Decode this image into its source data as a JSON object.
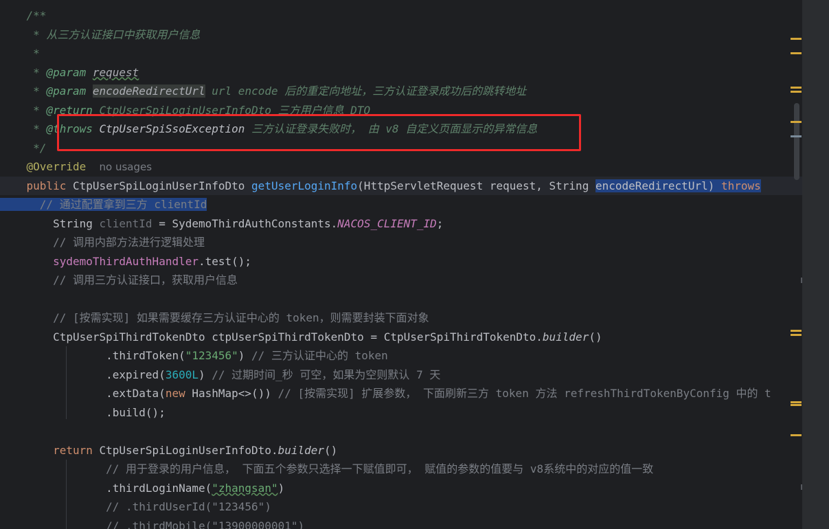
{
  "editor": {
    "lines": [
      {
        "segs": [
          [
            "    /**",
            "doc"
          ]
        ]
      },
      {
        "segs": [
          [
            "     * 从三方认证接口中获取用户信息",
            "doc"
          ]
        ]
      },
      {
        "segs": [
          [
            "     *",
            "doc"
          ]
        ]
      },
      {
        "segs": [
          [
            "     * ",
            "doc"
          ],
          [
            "@param",
            "doctag"
          ],
          [
            " ",
            "doc"
          ],
          [
            "request",
            "docparam"
          ]
        ]
      },
      {
        "segs": [
          [
            "     * ",
            "doc"
          ],
          [
            "@param",
            "doctag"
          ],
          [
            " ",
            "doc"
          ],
          [
            "encodeRedirectUrl",
            "docparamhl"
          ],
          [
            " url encode 后的重定向地址，三方认证登录成功后的跳转地址",
            "doc"
          ]
        ]
      },
      {
        "segs": [
          [
            "     * ",
            "doc"
          ],
          [
            "@return",
            "doctag"
          ],
          [
            " CtpUserSpiLoginUserInfoDto 三方用户信息 DTO",
            "doc"
          ]
        ]
      },
      {
        "segs": [
          [
            "     * ",
            "doc"
          ],
          [
            "@throws",
            "doctag"
          ],
          [
            " ",
            "doc"
          ],
          [
            "CtpUserSpiSsoException",
            "docref"
          ],
          [
            " 三方认证登录失败时， 由 v8 自定义页面显示的异常信息",
            "doc"
          ]
        ]
      },
      {
        "segs": [
          [
            "     */",
            "doc"
          ]
        ]
      },
      {
        "segs": [
          [
            "    ",
            ""
          ],
          [
            "@Override",
            "ann"
          ],
          [
            "  ",
            ""
          ],
          [
            "no usages",
            "hint"
          ]
        ]
      },
      {
        "segs": [
          [
            "    ",
            ""
          ],
          [
            "public",
            "kw"
          ],
          [
            " CtpUserSpiLoginUserInfoDto ",
            ""
          ],
          [
            "getUserLoginInfo",
            "fn"
          ],
          [
            "(HttpServletRequest request, String ",
            ""
          ],
          [
            "encodeRedirectUrl",
            "sel"
          ],
          [
            ")",
            "selp"
          ],
          [
            " throws",
            "selkw"
          ]
        ],
        "caret": true
      },
      {
        "segs": [
          [
            "  ",
            "selbg"
          ],
          [
            "    // 通过配置拿到三方 clientId",
            "selcm"
          ]
        ]
      },
      {
        "segs": [
          [
            "        String ",
            ""
          ],
          [
            "clientId",
            "unused"
          ],
          [
            " = SydemoThirdAuthConstants.",
            ""
          ],
          [
            "NACOS_CLIENT_ID",
            "const"
          ],
          [
            ";",
            ""
          ]
        ]
      },
      {
        "segs": [
          [
            "        // 调用内部方法进行逻辑处理",
            "cm"
          ]
        ]
      },
      {
        "segs": [
          [
            "        ",
            ""
          ],
          [
            "sydemoThirdAuthHandler",
            "field"
          ],
          [
            ".test();",
            ""
          ]
        ]
      },
      {
        "segs": [
          [
            "        // 调用三方认证接口，获取用户信息",
            "cm"
          ]
        ]
      },
      {
        "segs": [
          [
            "",
            ""
          ]
        ]
      },
      {
        "segs": [
          [
            "        // [按需实现] 如果需要缓存三方认证中心的 token，则需要封装下面对象",
            "cm"
          ]
        ]
      },
      {
        "segs": [
          [
            "        CtpUserSpiThirdTokenDto ctpUserSpiThirdTokenDto = CtpUserSpiThirdTokenDto.",
            ""
          ],
          [
            "builder",
            "static"
          ],
          [
            "()",
            ""
          ]
        ]
      },
      {
        "segs": [
          [
            "                .thirdToken(",
            ""
          ],
          [
            "\"123456\"",
            "str"
          ],
          [
            ") ",
            ""
          ],
          [
            "// 三方认证中心的 token",
            "cm"
          ]
        ]
      },
      {
        "segs": [
          [
            "                .expired(",
            ""
          ],
          [
            "3600L",
            "num"
          ],
          [
            ") ",
            ""
          ],
          [
            "// 过期时间_秒 可空，如果为空则默认 7 天",
            "cm"
          ]
        ]
      },
      {
        "segs": [
          [
            "                .extData(",
            ""
          ],
          [
            "new",
            "kw"
          ],
          [
            " HashMap<>()) ",
            ""
          ],
          [
            "// [按需实现] 扩展参数， 下面刷新三方 token 方法 refreshThirdTokenByConfig 中的 t",
            "cm"
          ]
        ]
      },
      {
        "segs": [
          [
            "                .build();",
            ""
          ]
        ]
      },
      {
        "segs": [
          [
            "",
            ""
          ]
        ]
      },
      {
        "segs": [
          [
            "        ",
            ""
          ],
          [
            "return",
            "kw"
          ],
          [
            " CtpUserSpiLoginUserInfoDto.",
            ""
          ],
          [
            "builder",
            "static"
          ],
          [
            "()",
            ""
          ]
        ]
      },
      {
        "segs": [
          [
            "                // 用于登录的用户信息， 下面五个参数只选择一下赋值即可， 赋值的参数的值要与 v8系统中的对应的值一致",
            "cm"
          ]
        ]
      },
      {
        "segs": [
          [
            "                .thirdLoginName(",
            ""
          ],
          [
            "\"zhangsan\"",
            "strsq"
          ],
          [
            ")",
            ""
          ]
        ]
      },
      {
        "segs": [
          [
            "                // .thirdUserId(\"123456\")",
            "cm"
          ]
        ]
      },
      {
        "segs": [
          [
            "                // .thirdMobile(\"13900000001\")",
            "cm"
          ]
        ]
      }
    ]
  },
  "colors": {
    "background": "#1e1f22",
    "highlight_box": "#ee2a2a",
    "selection": "#214283",
    "warning_mark": "#d4a73a"
  }
}
